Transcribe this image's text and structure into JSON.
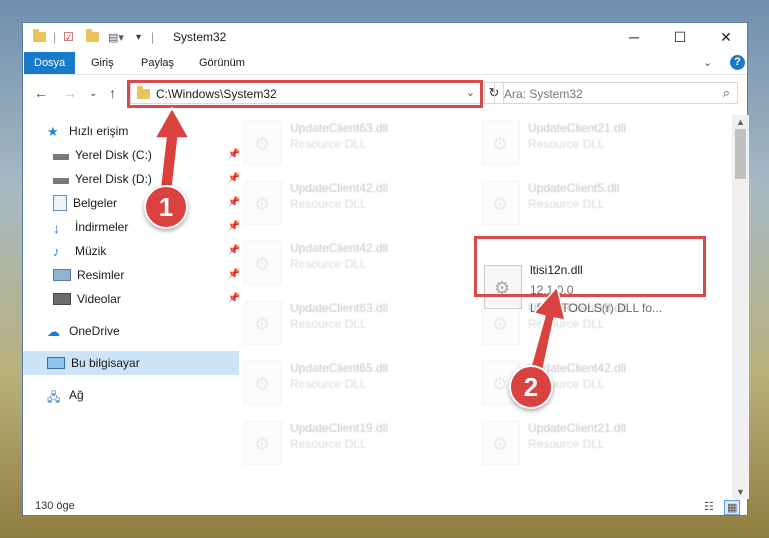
{
  "window": {
    "title": "System32",
    "controls": {
      "minimize": "─",
      "maximize": "☐",
      "close": "✕"
    }
  },
  "ribbon": {
    "tabs": [
      "Dosya",
      "Giriş",
      "Paylaş",
      "Görünüm"
    ],
    "active_tab": "Dosya",
    "help": "?"
  },
  "navigation": {
    "address_path": "C:\\Windows\\System32",
    "search_placeholder": "Ara: System32"
  },
  "sidebar": {
    "items": [
      {
        "label": "Hızlı erişim",
        "icon": "star-icon",
        "pinned": false
      },
      {
        "label": "Yerel Disk (C:)",
        "icon": "drive-icon",
        "pinned": true
      },
      {
        "label": "Yerel Disk (D:)",
        "icon": "drive-icon",
        "pinned": true
      },
      {
        "label": "Belgeler",
        "icon": "documents-icon",
        "pinned": true
      },
      {
        "label": "İndirmeler",
        "icon": "download-icon",
        "pinned": true
      },
      {
        "label": "Müzik",
        "icon": "music-icon",
        "pinned": true
      },
      {
        "label": "Resimler",
        "icon": "pictures-icon",
        "pinned": true
      },
      {
        "label": "Videolar",
        "icon": "video-icon",
        "pinned": true
      },
      {
        "label": "OneDrive",
        "icon": "cloud-icon",
        "pinned": false
      },
      {
        "label": "Bu bilgisayar",
        "icon": "computer-icon",
        "pinned": false,
        "selected": true
      },
      {
        "label": "Ağ",
        "icon": "network-icon",
        "pinned": false
      }
    ]
  },
  "files": [
    {
      "name": "UpdateClient63.dll",
      "subtitle": "Resource DLL"
    },
    {
      "name": "UpdateClient21.dll",
      "subtitle": "Resource DLL"
    },
    {
      "name": "UpdateClient42.dll",
      "subtitle": "Resource DLL"
    },
    {
      "name": "UpdateClient5.dll",
      "subtitle": "Resource DLL"
    },
    {
      "name": "UpdateClient42.dll",
      "subtitle": "Resource DLL"
    },
    {
      "name": "ltisi12n.dll",
      "version": "12.1.0.0",
      "subtitle": "LEADTOOLS(r) DLL fo...",
      "highlighted": true
    },
    {
      "name": "UpdateClient63.dll",
      "subtitle": "Resource DLL"
    },
    {
      "name": "UpdateClient19.dll",
      "subtitle": "Resource DLL"
    },
    {
      "name": "UpdateClient65.dll",
      "subtitle": "Resource DLL"
    },
    {
      "name": "UpdateClient42.dll",
      "subtitle": "Resource DLL"
    },
    {
      "name": "UpdateClient19.dll",
      "subtitle": "Resource DLL"
    },
    {
      "name": "UpdateClient21.dll",
      "subtitle": "Resource DLL"
    }
  ],
  "status": {
    "item_count": "130 öge"
  },
  "annotations": {
    "badge1": "1",
    "badge2": "2",
    "color": "#d9423f"
  },
  "colors": {
    "accent": "#1979ca",
    "selection": "#cce4f7",
    "highlight": "#d94b4b"
  }
}
